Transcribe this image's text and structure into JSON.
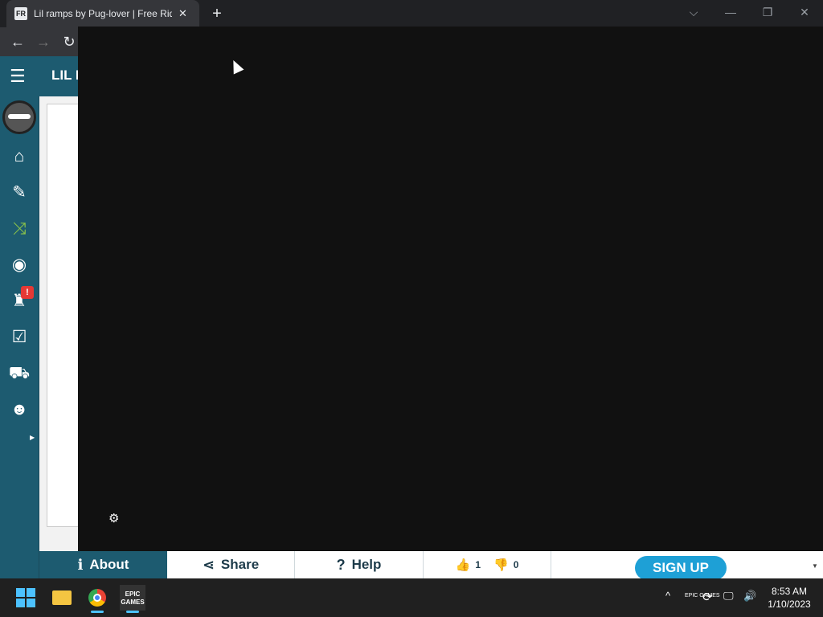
{
  "browser": {
    "tab_title": "Lil ramps by Pug-lover | Free Rider",
    "tab_close": "✕",
    "new_tab": "+",
    "controls": {
      "dropdown": "⌵",
      "minimize": "—",
      "maximize": "❐",
      "close": "✕"
    },
    "nav": {
      "back": "←",
      "forward": "→",
      "reload": "↻"
    }
  },
  "page": {
    "menu_icon": "☰",
    "title": "LIL R",
    "sidebar": [
      {
        "name": "home-icon",
        "glyph": "⌂"
      },
      {
        "name": "edit-icon",
        "glyph": "✎"
      },
      {
        "name": "shuffle-icon",
        "glyph": "⤨"
      },
      {
        "name": "globe-icon",
        "glyph": "◉"
      },
      {
        "name": "achievements-icon",
        "glyph": "♜"
      },
      {
        "name": "checklist-icon",
        "glyph": "☑"
      },
      {
        "name": "cart-icon",
        "glyph": "⛟"
      },
      {
        "name": "community-icon",
        "glyph": "☻"
      }
    ],
    "notification_badge": "!",
    "expand_arrow": "▶",
    "settings_icon": "⚙",
    "bottom": {
      "about": "About",
      "share": "Share",
      "help": "Help",
      "likes": "1",
      "dislikes": "0",
      "signup": "SIGN UP",
      "about_icon": "ℹ",
      "share_icon": "⋖",
      "help_icon": "?",
      "like_icon": "👍",
      "dislike_icon": "👎",
      "scroll_icon": "▼"
    }
  },
  "taskbar": {
    "time": "8:53 AM",
    "date": "1/10/2023",
    "epic_label": "EPIC GAMES",
    "tray": {
      "chevron": "^",
      "sync": "⟳",
      "network": "🖵",
      "volume": "🔊"
    }
  }
}
